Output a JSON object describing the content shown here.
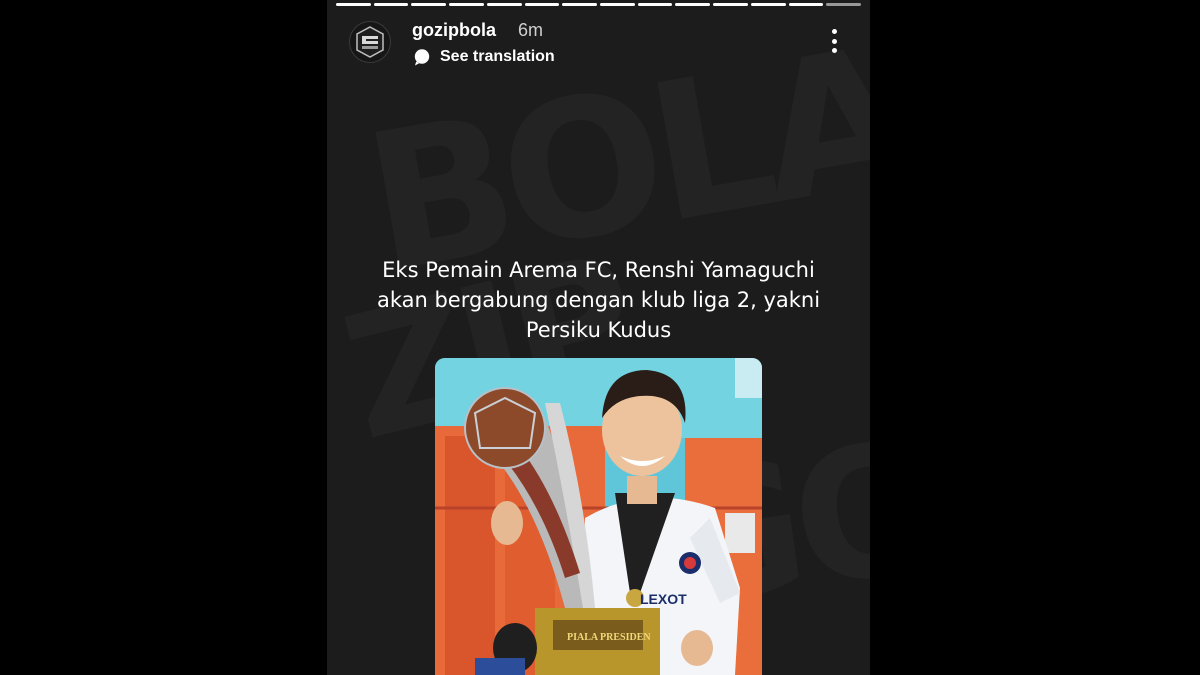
{
  "story": {
    "username": "gozipbola",
    "time": "6m",
    "translation_label": "See translation",
    "segment_count": 14,
    "active_segment": 14,
    "caption_lines": [
      "Eks Pemain Arema FC, Renshi Yamaguchi",
      "akan bergabung dengan klub liga 2, yakni",
      "Persiku Kudus"
    ],
    "icons": {
      "avatar": "gozipbola-logo-icon",
      "translate": "translate-bubble-icon",
      "more": "more-options-icon"
    },
    "colors": {
      "background": "#1c1c1c",
      "page": "#000000",
      "text": "#ffffff",
      "time": "#cfcfcf"
    }
  }
}
